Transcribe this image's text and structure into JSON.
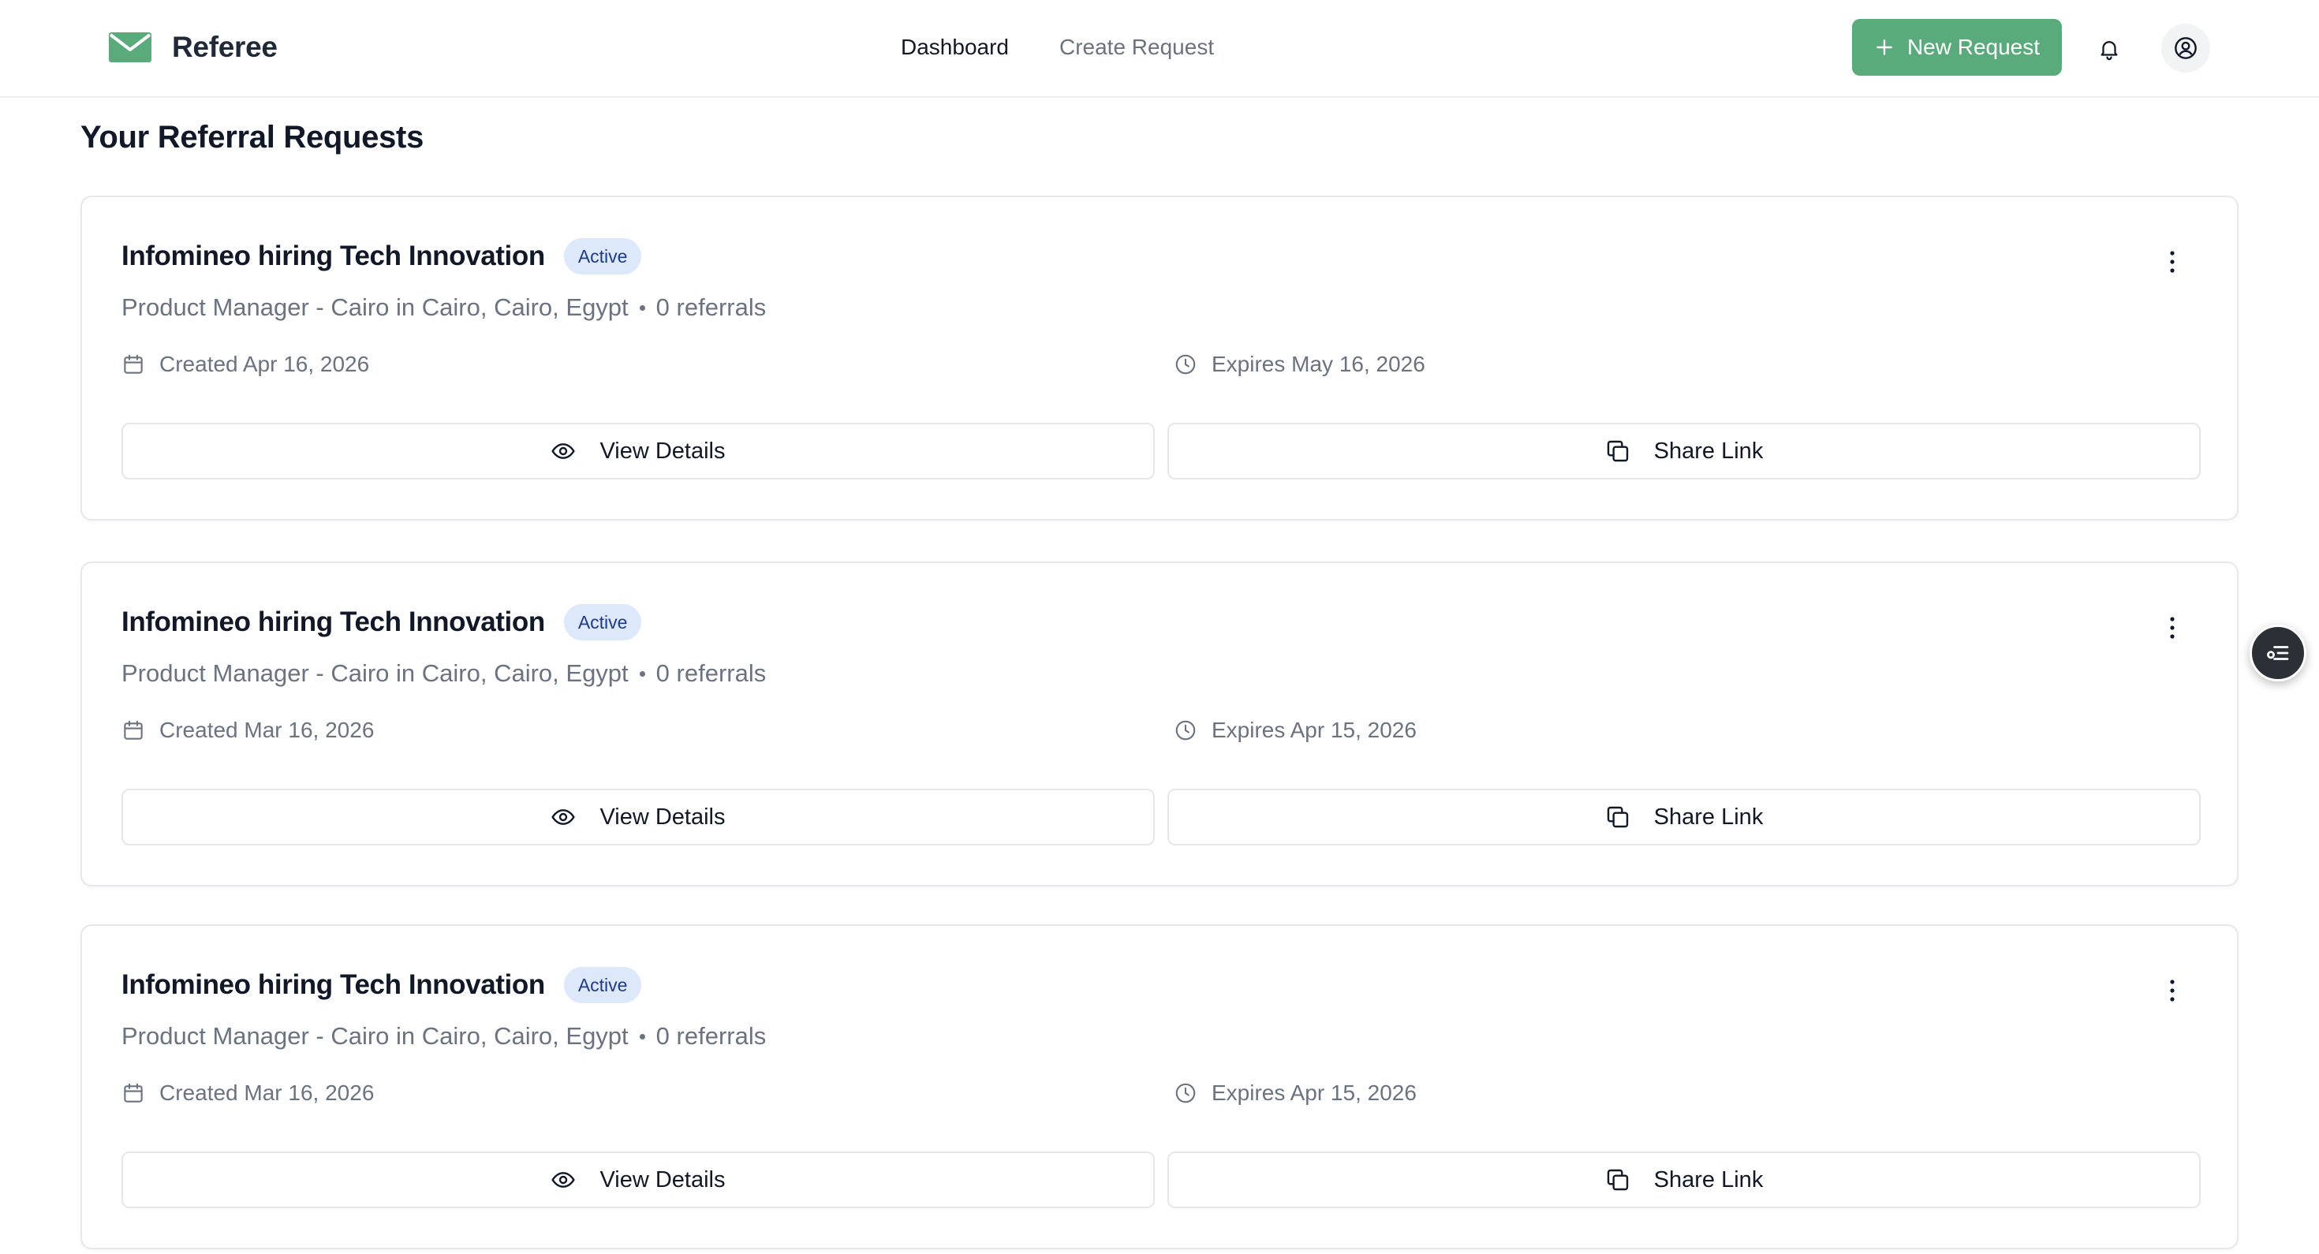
{
  "header": {
    "brand_name": "Referee",
    "nav": [
      {
        "label": "Dashboard",
        "active": true
      },
      {
        "label": "Create Request",
        "active": false
      }
    ],
    "new_request_label": "New Request",
    "brand_color": "#5aab7c"
  },
  "page": {
    "title": "Your Referral Requests"
  },
  "requests": [
    {
      "title": "Infomineo hiring Tech Innovation",
      "status": "Active",
      "role_location": "Product Manager - Cairo in Cairo, Cairo, Egypt",
      "referrals": "0 referrals",
      "created": "Created Apr 16, 2026",
      "expires": "Expires May 16, 2026",
      "view_label": "View Details",
      "share_label": "Share Link"
    },
    {
      "title": "Infomineo hiring Tech Innovation",
      "status": "Active",
      "role_location": "Product Manager - Cairo in Cairo, Cairo, Egypt",
      "referrals": "0 referrals",
      "created": "Created Mar 16, 2026",
      "expires": "Expires Apr 15, 2026",
      "view_label": "View Details",
      "share_label": "Share Link"
    },
    {
      "title": "Infomineo hiring Tech Innovation",
      "status": "Active",
      "role_location": "Product Manager - Cairo in Cairo, Cairo, Egypt",
      "referrals": "0 referrals",
      "created": "Created Mar 16, 2026",
      "expires": "Expires Apr 15, 2026",
      "view_label": "View Details",
      "share_label": "Share Link"
    }
  ],
  "icons": {
    "brand": "envelope-icon",
    "new_request": "plus-icon",
    "notifications": "bell-icon",
    "account": "user-circle-icon",
    "menu": "more-vertical-icon",
    "created": "calendar-icon",
    "expires": "clock-icon",
    "view": "eye-icon",
    "share": "copy-icon",
    "floating": "list-filter-icon"
  }
}
